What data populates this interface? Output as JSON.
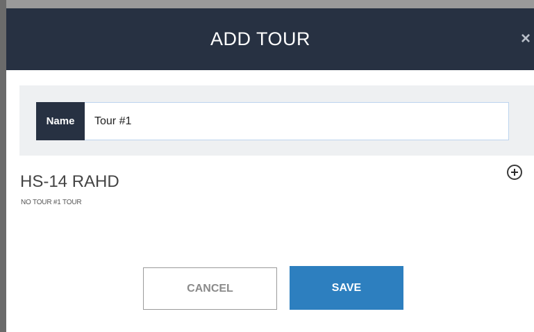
{
  "modal": {
    "title": "ADD TOUR",
    "close_glyph": "×",
    "close_icon": "close-icon"
  },
  "name_field": {
    "label": "Name",
    "value": "Tour #1"
  },
  "tour": {
    "heading": "HS-14 RAHD",
    "subtext": "NO TOUR #1 TOUR",
    "add_icon": "plus-circle-icon"
  },
  "actions": {
    "cancel_label": "CANCEL",
    "save_label": "SAVE"
  },
  "colors": {
    "header_bg": "#273142",
    "panel_bg": "#eef0f2",
    "save_bg": "#2d7fbf"
  }
}
